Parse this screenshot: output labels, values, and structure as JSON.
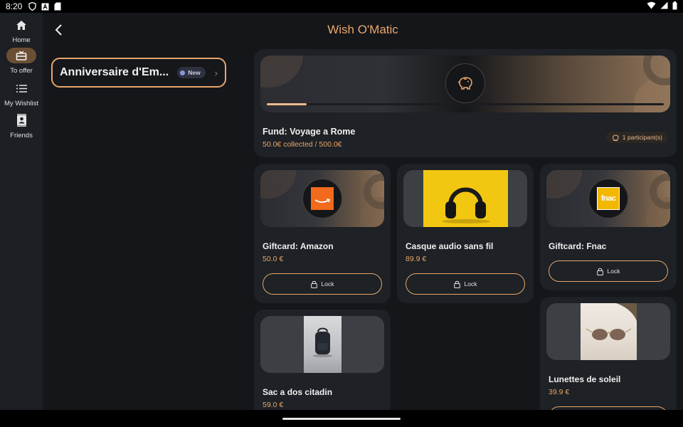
{
  "status_bar": {
    "time": "8:20"
  },
  "nav_rail": {
    "items": [
      {
        "label": "Home",
        "icon": "home-icon",
        "active": false
      },
      {
        "label": "To offer",
        "icon": "gift-icon",
        "active": true
      },
      {
        "label": "My Wishlist",
        "icon": "list-icon",
        "active": false
      },
      {
        "label": "Friends",
        "icon": "contact-icon",
        "active": false
      }
    ]
  },
  "header": {
    "title": "Wish O'Matic"
  },
  "event": {
    "name": "Anniversaire d'Em...",
    "badge": "New"
  },
  "fund": {
    "title": "Fund: Voyage a Rome",
    "collected": "50.0€ collected / 500.0€",
    "progress": 0.1,
    "participants": "1 participant(s)"
  },
  "items": [
    {
      "title": "Giftcard: Amazon",
      "price": "50.0 €",
      "action": "Lock"
    },
    {
      "title": "Casque audio sans fil",
      "price": "89.9 €",
      "action": "Lock"
    },
    {
      "title": "Giftcard: Fnac",
      "price": "",
      "action": "Lock"
    },
    {
      "title": "Sac a dos citadin",
      "price": "59.0 €"
    },
    {
      "title": "Lunettes de soleil",
      "price": "39.9 €"
    }
  ],
  "logos": {
    "fnac": "fnac"
  },
  "colors": {
    "accent": "#e9a66b",
    "background": "#141619",
    "card": "#1e2125",
    "rail": "#1c1f23"
  }
}
